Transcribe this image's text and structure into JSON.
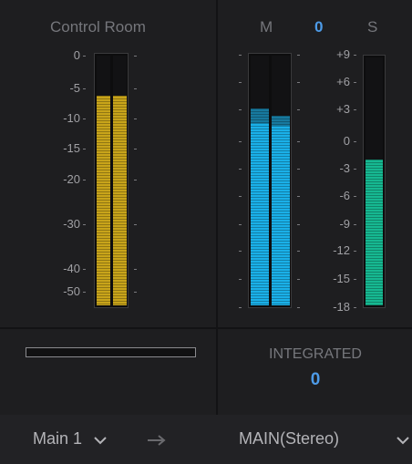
{
  "left_panel": {
    "title": "Control Room",
    "scale": [
      "0",
      "-5",
      "-10",
      "-15",
      "-20",
      "-30",
      "-40",
      "-50"
    ],
    "levels_percent": [
      84,
      84
    ],
    "bar_color": "#c8a41a"
  },
  "right_panel": {
    "title_m": "M",
    "title_value": "0",
    "title_s": "S",
    "m_scale": [
      "+9",
      "+6",
      "+3",
      "0",
      "-3",
      "-6",
      "-9",
      "-12",
      "-15",
      "-18"
    ],
    "m_levels_percent": [
      79,
      76
    ],
    "m_color": "#1ab0e8",
    "s_level_percent": 59,
    "s_color": "#16b891"
  },
  "integrated": {
    "label": "INTEGRATED",
    "value": "0"
  },
  "footer": {
    "input_label": "Main 1",
    "output_label": "MAIN(Stereo)",
    "icons": [
      "chevron-down-icon",
      "arrow-right-icon",
      "chevron-down-icon"
    ]
  },
  "colors": {
    "accent": "#4d9be8",
    "panel_bg": "#1e1e20"
  }
}
